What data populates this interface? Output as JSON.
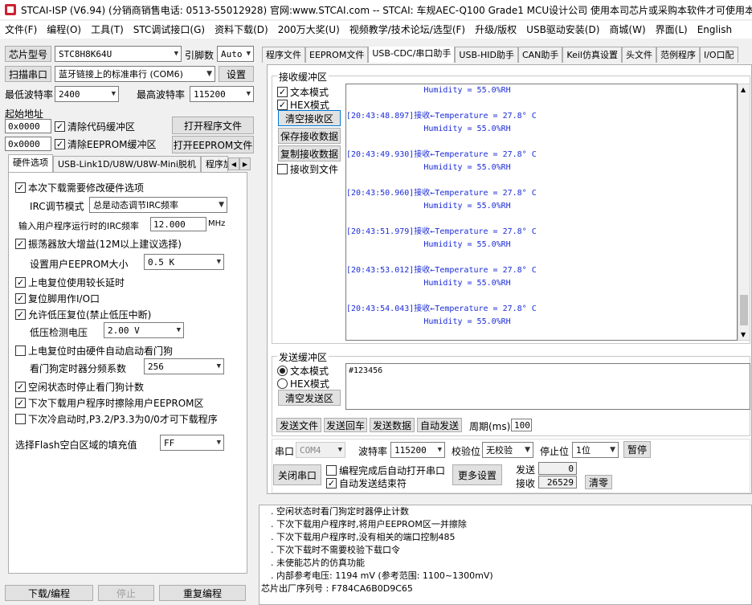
{
  "window": {
    "title": "STCAI-ISP (V6.94) (分销商销售电话: 0513-55012928) 官网:www.STCAI.com  -- STCAI: 车规AEC-Q100 Grade1 MCU设计公司 使用本司芯片或采购本软件才可使用本软件"
  },
  "menu": [
    "文件(F)",
    "编程(O)",
    "工具(T)",
    "STC调试接口(G)",
    "资料下载(D)",
    "200万大奖(U)",
    "视频教学/技术论坛/选型(F)",
    "升级/版权",
    "USB驱动安装(D)",
    "商城(W)",
    "界面(L)",
    "English"
  ],
  "chip": {
    "label": "芯片型号",
    "value": "STC8H8K64U",
    "pins_label": "引脚数",
    "pins_value": "Auto"
  },
  "port": {
    "scan_button": "扫描串口",
    "value": "蓝牙链接上的标准串行 (COM6)",
    "settings_button": "设置"
  },
  "baud": {
    "min_label": "最低波特率",
    "min_value": "2400",
    "max_label": "最高波特率",
    "max_value": "115200"
  },
  "addr": {
    "label": "起始地址",
    "code_addr": "0x0000",
    "clear_code": "清除代码缓冲区",
    "open_program": "打开程序文件",
    "eeprom_addr": "0x0000",
    "clear_eeprom": "清除EEPROM缓冲区",
    "open_eeprom": "打开EEPROM文件"
  },
  "left_tabs": [
    "硬件选项",
    "USB-Link1D/U8W/U8W-Mini脱机",
    "程序加"
  ],
  "hw": {
    "opt1": "本次下载需要修改硬件选项",
    "irc_mode_label": "IRC调节模式",
    "irc_mode_value": "总是动态调节IRC频率",
    "freq_label": "输入用户程序运行时的IRC频率",
    "freq_value": "12.000",
    "freq_unit": "MHz",
    "opt2": "振荡器放大增益(12M以上建议选择)",
    "eeprom_size_label": "设置用户EEPROM大小",
    "eeprom_size_value": "0.5 K",
    "opt3": "上电复位使用较长延时",
    "opt4": "复位脚用作I/O口",
    "opt5": "允许低压复位(禁止低压中断)",
    "lvd_label": "低压检测电压",
    "lvd_value": "2.00 V",
    "opt6": "上电复位时由硬件自动启动看门狗",
    "wdt_label": "看门狗定时器分频系数",
    "wdt_value": "256",
    "opt7": "空闲状态时停止看门狗计数",
    "opt8": "下次下载用户程序时擦除用户EEPROM区",
    "opt9": "下次冷启动时,P3.2/P3.3为0/0才可下载程序",
    "fill_label": "选择Flash空白区域的填充值",
    "fill_value": "FF"
  },
  "bottom_left": {
    "download": "下载/编程",
    "stop": "停止",
    "reprogram": "重复编程"
  },
  "right_tabs": [
    "程序文件",
    "EEPROM文件",
    "USB-CDC/串口助手",
    "USB-HID助手",
    "CAN助手",
    "Keil仿真设置",
    "头文件",
    "范例程序",
    "I/O口配"
  ],
  "recv": {
    "title": "接收缓冲区",
    "text_mode": "文本模式",
    "hex_mode": "HEX模式",
    "clear": "清空接收区",
    "save": "保存接收数据",
    "copy": "复制接收数据",
    "to_file": "接收到文件",
    "lines": [
      "                Humidity = 55.0%RH",
      "",
      "[20:43:48.897]接收←Temperature = 27.8° C",
      "                Humidity = 55.0%RH",
      "",
      "[20:43:49.930]接收←Temperature = 27.8° C",
      "                Humidity = 55.0%RH",
      "",
      "[20:43:50.960]接收←Temperature = 27.8° C",
      "                Humidity = 55.0%RH",
      "",
      "[20:43:51.979]接收←Temperature = 27.8° C",
      "                Humidity = 55.0%RH",
      "",
      "[20:43:53.012]接收←Temperature = 27.8° C",
      "                Humidity = 55.0%RH",
      "",
      "[20:43:54.043]接收←Temperature = 27.8° C",
      "                Humidity = 55.0%RH"
    ]
  },
  "send": {
    "title": "发送缓冲区",
    "text_mode": "文本模式",
    "hex_mode": "HEX模式",
    "clear": "清空发送区",
    "content": "#123456",
    "send_file": "发送文件",
    "send_enter": "发送回车",
    "send_data": "发送数据",
    "auto_send": "自动发送",
    "period_label": "周期(ms)",
    "period_value": "100"
  },
  "serial": {
    "port_label": "串口",
    "port_value": "COM4",
    "baud_label": "波特率",
    "baud_value": "115200",
    "parity_label": "校验位",
    "parity_value": "无校验",
    "stop_label": "停止位",
    "stop_value": "1位",
    "pause": "暂停",
    "close_port": "关闭串口",
    "auto_open": "编程完成后自动打开串口",
    "auto_end": "自动发送结束符",
    "more": "更多设置",
    "sent_label": "发送",
    "sent_value": "0",
    "recv_label": "接收",
    "recv_value": "26529",
    "clear_count": "清零"
  },
  "log": {
    "lines": [
      ". 空闲状态时看门狗定时器停止计数",
      ". 下次下载用户程序时,将用户EEPROM区一并擦除",
      ". 下次下载用户程序时,没有相关的端口控制485",
      ". 下次下载时不需要校验下载口令",
      ". 未使能芯片的仿真功能",
      ". 内部参考电压: 1194 mV (参考范围: 1100~1300mV)"
    ],
    "serial_line": "芯片出厂序列号 : F784CA6B0D9C65"
  }
}
